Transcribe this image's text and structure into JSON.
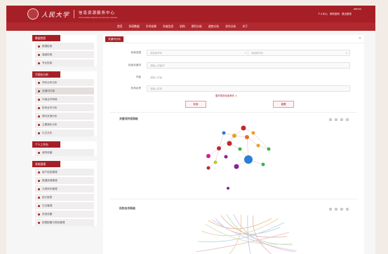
{
  "header": {
    "logo_text": "人民大学",
    "center_name": "信息资源服务中心",
    "center_en": "Information Resource Service Center",
    "user_name": "admin",
    "user_links": [
      "个人中心",
      "修改密码",
      "退出登录"
    ]
  },
  "nav": [
    "首页",
    "科研数据",
    "学术成果",
    "学者信息",
    "机构",
    "期刊分析",
    "趋势分析",
    "合作分析",
    "关于"
  ],
  "sidebar": {
    "groups": [
      {
        "title": "数据检索",
        "items": [
          "数据检索",
          "高级检索",
          "专业检索"
        ]
      },
      {
        "title": "可视化分析",
        "items": [
          "学科分布分析",
          "关键词共现",
          "作者合作网络",
          "机构合作分析",
          "期刊来源分析",
          "主题演化分析",
          "引文分析"
        ]
      },
      {
        "title": "个人工作台",
        "items": [
          "我的收藏"
        ]
      },
      {
        "title": "系统管理",
        "items": [
          "用户信息管理",
          "数据资源管理",
          "分类体系管理",
          "统计报表",
          "日志管理",
          "系统设置",
          "权限配置与角色管理"
        ]
      }
    ],
    "active_item": "关键词共现"
  },
  "main": {
    "tab_label": "关键词分析",
    "close_symbol": "×",
    "form": {
      "row1_label": "检索范围",
      "select1_value": "请选择学科",
      "select2_value": "请选择年份",
      "row2_label": "检索关键词",
      "row2_placeholder": "请输入关键词",
      "row3_label": "作者",
      "row3_placeholder": "请输入作者",
      "row4_label": "机构名称",
      "row4_placeholder": "请输入机构",
      "advanced_link": "展开更多检索条件 ∨",
      "search_button": "检索",
      "reset_button": "重置"
    },
    "section1_title": "关键词共现网络",
    "section2_title": "机构合作网络"
  },
  "colors": {
    "brand_red": "#a61f26",
    "node_colors": [
      "#c0282f",
      "#8e1f9e",
      "#2a7fd4",
      "#3fb14a",
      "#e7a21f",
      "#e86a2a",
      "#d11f8f",
      "#b8c926"
    ]
  }
}
